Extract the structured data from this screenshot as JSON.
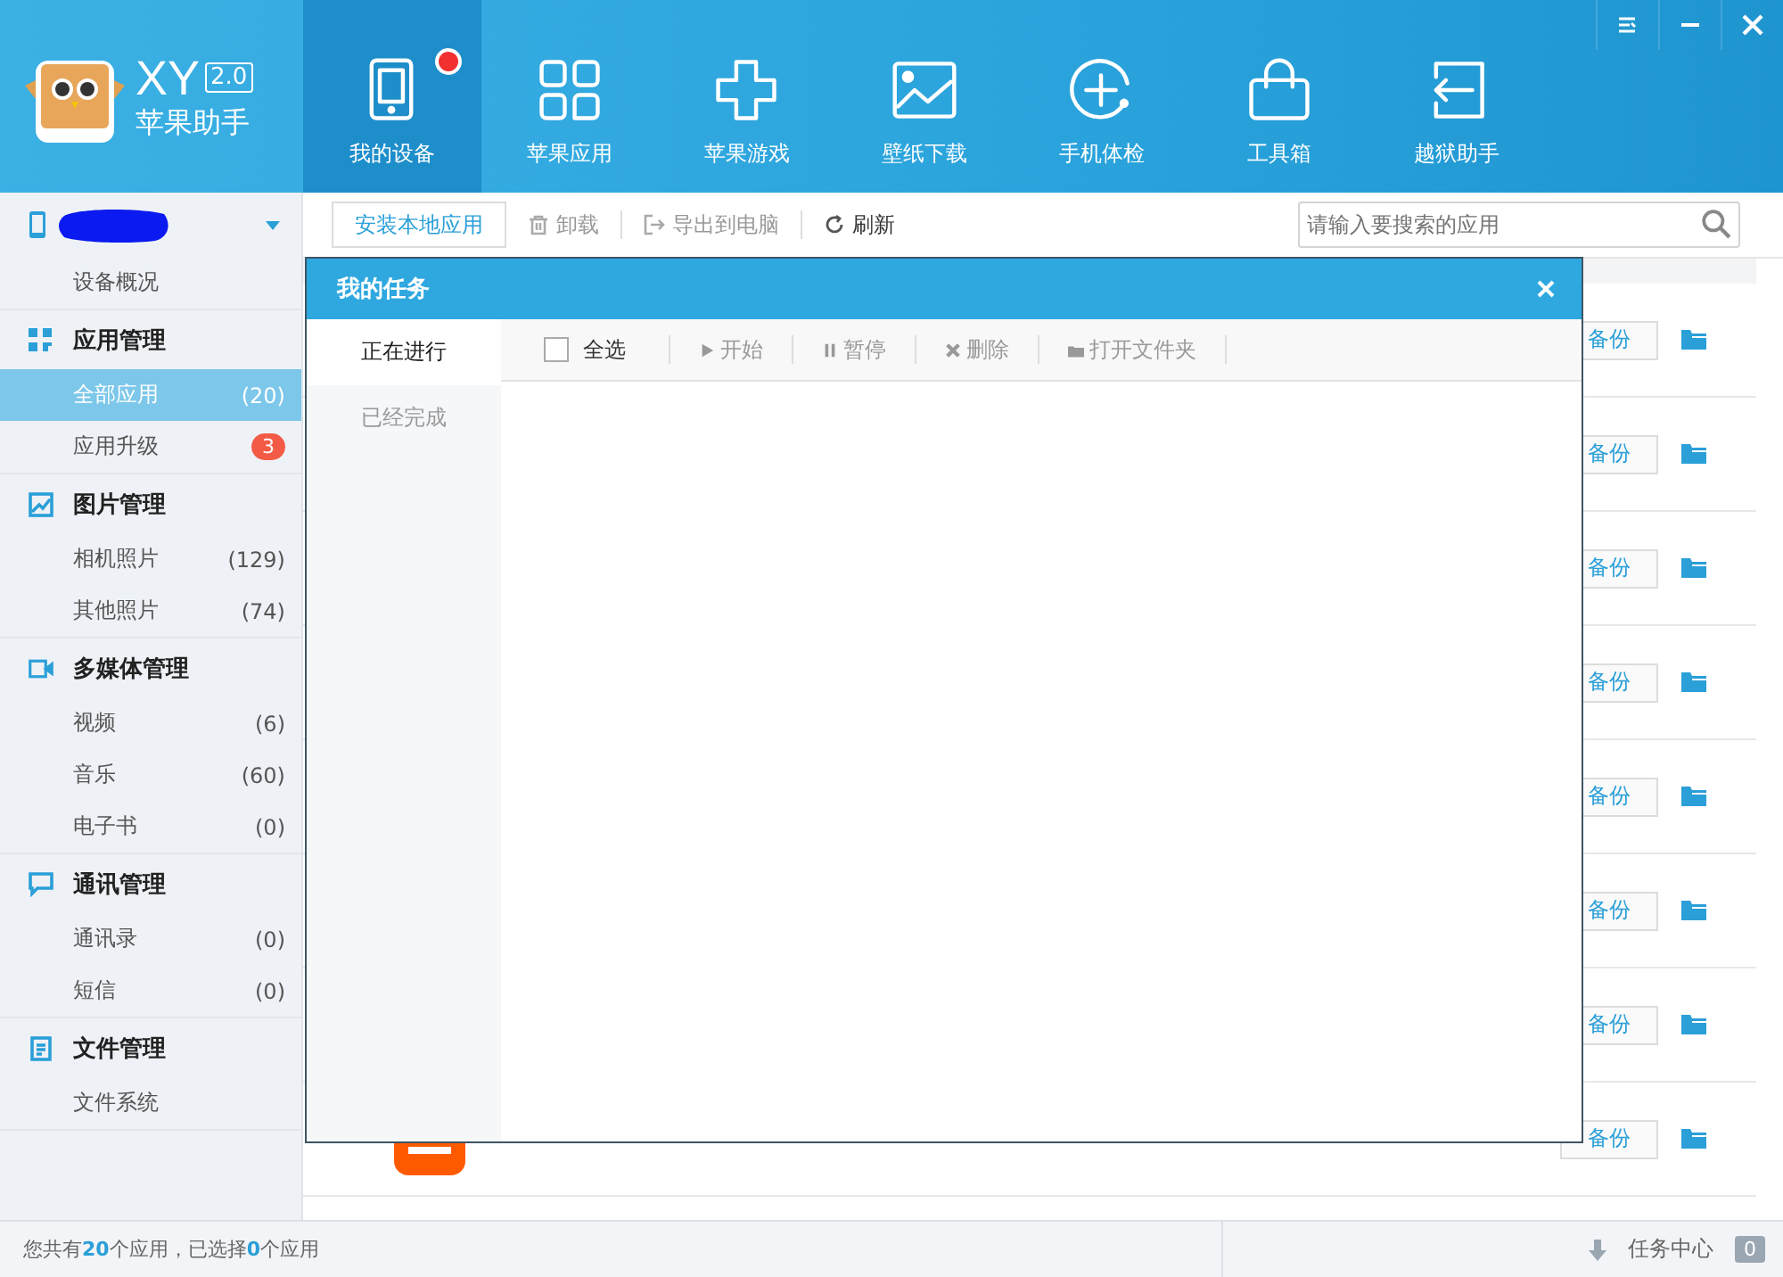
{
  "logo": {
    "name": "XY",
    "version": "2.0",
    "subtitle": "苹果助手"
  },
  "nav": [
    {
      "label": "我的设备",
      "selected": true,
      "notify": true
    },
    {
      "label": "苹果应用",
      "selected": false,
      "notify": false
    },
    {
      "label": "苹果游戏",
      "selected": false,
      "notify": false
    },
    {
      "label": "壁纸下载",
      "selected": false,
      "notify": false
    },
    {
      "label": "手机体检",
      "selected": false,
      "notify": false
    },
    {
      "label": "工具箱",
      "selected": false,
      "notify": false
    },
    {
      "label": "越狱助手",
      "selected": false,
      "notify": false
    }
  ],
  "toolbar": {
    "buttons": [
      {
        "label": "安装本地应用",
        "kind": "primary",
        "disabled": false
      },
      {
        "label": "卸载",
        "kind": "plain",
        "disabled": true
      },
      {
        "label": "导出到电脑",
        "kind": "plain",
        "disabled": true
      },
      {
        "label": "刷新",
        "kind": "plain",
        "disabled": false
      }
    ],
    "search": {
      "placeholder": "请输入要搜索的应用"
    }
  },
  "sidebar": [
    {
      "items": [
        {
          "label": "设备概况",
          "selected": false
        }
      ]
    },
    {
      "title": "应用管理",
      "items": [
        {
          "label": "全部应用",
          "count": "(20)",
          "selected": true
        },
        {
          "label": "应用升级",
          "badge": "3",
          "selected": false
        }
      ]
    },
    {
      "title": "图片管理",
      "items": [
        {
          "label": "相机照片",
          "count": "(129)",
          "selected": false
        },
        {
          "label": "其他照片",
          "count": "(74)",
          "selected": false
        }
      ]
    },
    {
      "title": "多媒体管理",
      "items": [
        {
          "label": "视频",
          "count": "(6)",
          "selected": false
        },
        {
          "label": "音乐",
          "count": "(60)",
          "selected": false
        },
        {
          "label": "电子书",
          "count": "(0)",
          "selected": false
        }
      ]
    },
    {
      "title": "通讯管理",
      "items": [
        {
          "label": "通讯录",
          "count": "(0)",
          "selected": false
        },
        {
          "label": "短信",
          "count": "(0)",
          "selected": false
        }
      ]
    },
    {
      "title": "文件管理",
      "items": [
        {
          "label": "文件系统",
          "selected": false
        }
      ]
    }
  ],
  "list": {
    "rows": [
      {
        "action": "备份"
      },
      {
        "action": "备份"
      },
      {
        "action": "备份"
      },
      {
        "action": "备份"
      },
      {
        "action": "备份"
      },
      {
        "action": "备份"
      },
      {
        "action": "备份"
      },
      {
        "action": "备份",
        "kind": "picture"
      }
    ]
  },
  "dialog": {
    "title": "我的任务",
    "tabs": [
      {
        "label": "正在进行",
        "selected": true
      },
      {
        "label": "已经完成",
        "selected": false
      }
    ],
    "select_all": {
      "label": "全选",
      "checked": false
    },
    "actions": [
      {
        "label": "开始"
      },
      {
        "label": "暂停"
      },
      {
        "label": "删除"
      },
      {
        "label": "打开文件夹"
      }
    ]
  },
  "status_bar": {
    "summary": "您共有**20**个应用，已选择**0**个应用",
    "task_center": "任务中心",
    "task_count": "0"
  }
}
